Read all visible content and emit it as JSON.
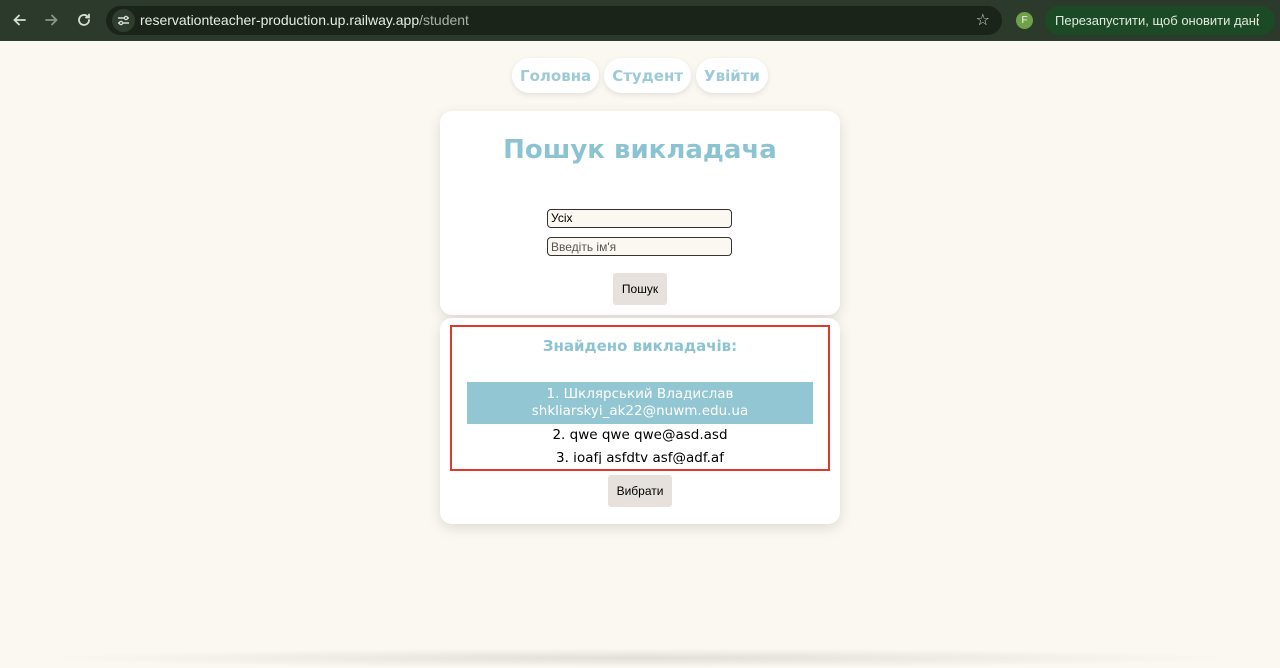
{
  "browser": {
    "url_host": "reservationteacher-production.up.railway.app",
    "url_path": "/student",
    "profile_initial": "F",
    "update_label": "Перезапустити, щоб оновити дані"
  },
  "nav": {
    "items": [
      "Головна",
      "Студент",
      "Увійти"
    ]
  },
  "search": {
    "title": "Пошук викладача",
    "filter_value": "Усіх",
    "name_placeholder": "Введіть ім'я",
    "search_button": "Пошук"
  },
  "results": {
    "title": "Знайдено викладачів:",
    "items": [
      {
        "line1": "1. Шклярський Владислав",
        "line2": "shkliarskyi_ak22@nuwm.edu.ua",
        "selected": true
      },
      {
        "line1": "2. qwe qwe qwe@asd.asd",
        "line2": "",
        "selected": false
      },
      {
        "line1": "3. ioafj asfdtv asf@adf.af",
        "line2": "",
        "selected": false
      }
    ],
    "select_button": "Вибрати"
  },
  "colors": {
    "accent": "#8cc3d2",
    "selected_row": "#92c6d2",
    "page_bg": "#fbf8f1",
    "highlight_frame": "#e0392b"
  }
}
